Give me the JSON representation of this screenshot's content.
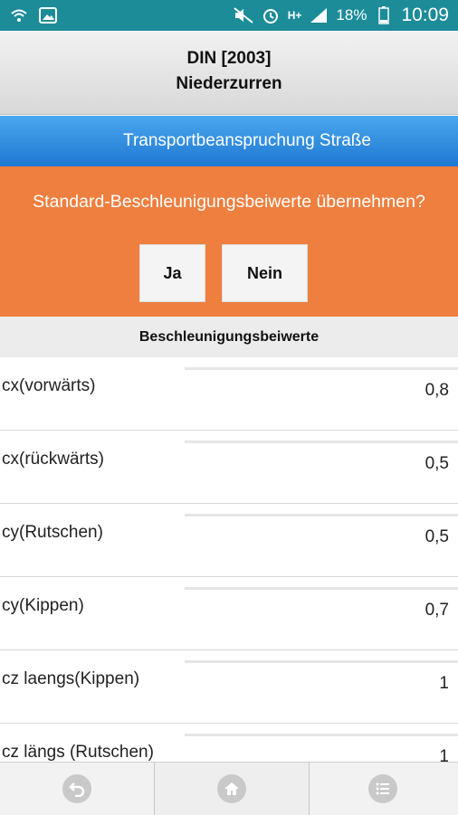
{
  "status_bar": {
    "time": "10:09",
    "battery": "18%",
    "network": "H+",
    "icons": [
      "wifi-icon",
      "image-icon",
      "mute-icon",
      "alarm-icon",
      "signal-icon",
      "battery-icon"
    ]
  },
  "header": {
    "title_line1": "DIN [2003]",
    "title_line2": "Niederzurren"
  },
  "subheader": {
    "title": "Transportbeanspruchung Straße"
  },
  "prompt": {
    "question": "Standard-Beschleunigungsbeiwerte übernehmen?",
    "yes_label": "Ja",
    "no_label": "Nein"
  },
  "section": {
    "title": "Beschleunigungsbeiwerte"
  },
  "rows": [
    {
      "label": "cx(vorwärts)",
      "value": "0,8"
    },
    {
      "label": "cx(rückwärts)",
      "value": "0,5"
    },
    {
      "label": "cy(Rutschen)",
      "value": "0,5"
    },
    {
      "label": "cy(Kippen)",
      "value": "0,7"
    },
    {
      "label": "cz laengs(Kippen)",
      "value": "1"
    },
    {
      "label": "cz längs (Rutschen)",
      "value": "1"
    }
  ],
  "bottom_nav": [
    "back-icon",
    "home-icon",
    "menu-icon"
  ],
  "colors": {
    "status": "#1c8c99",
    "blue": "#2a86dd",
    "orange": "#ee7f3f"
  }
}
